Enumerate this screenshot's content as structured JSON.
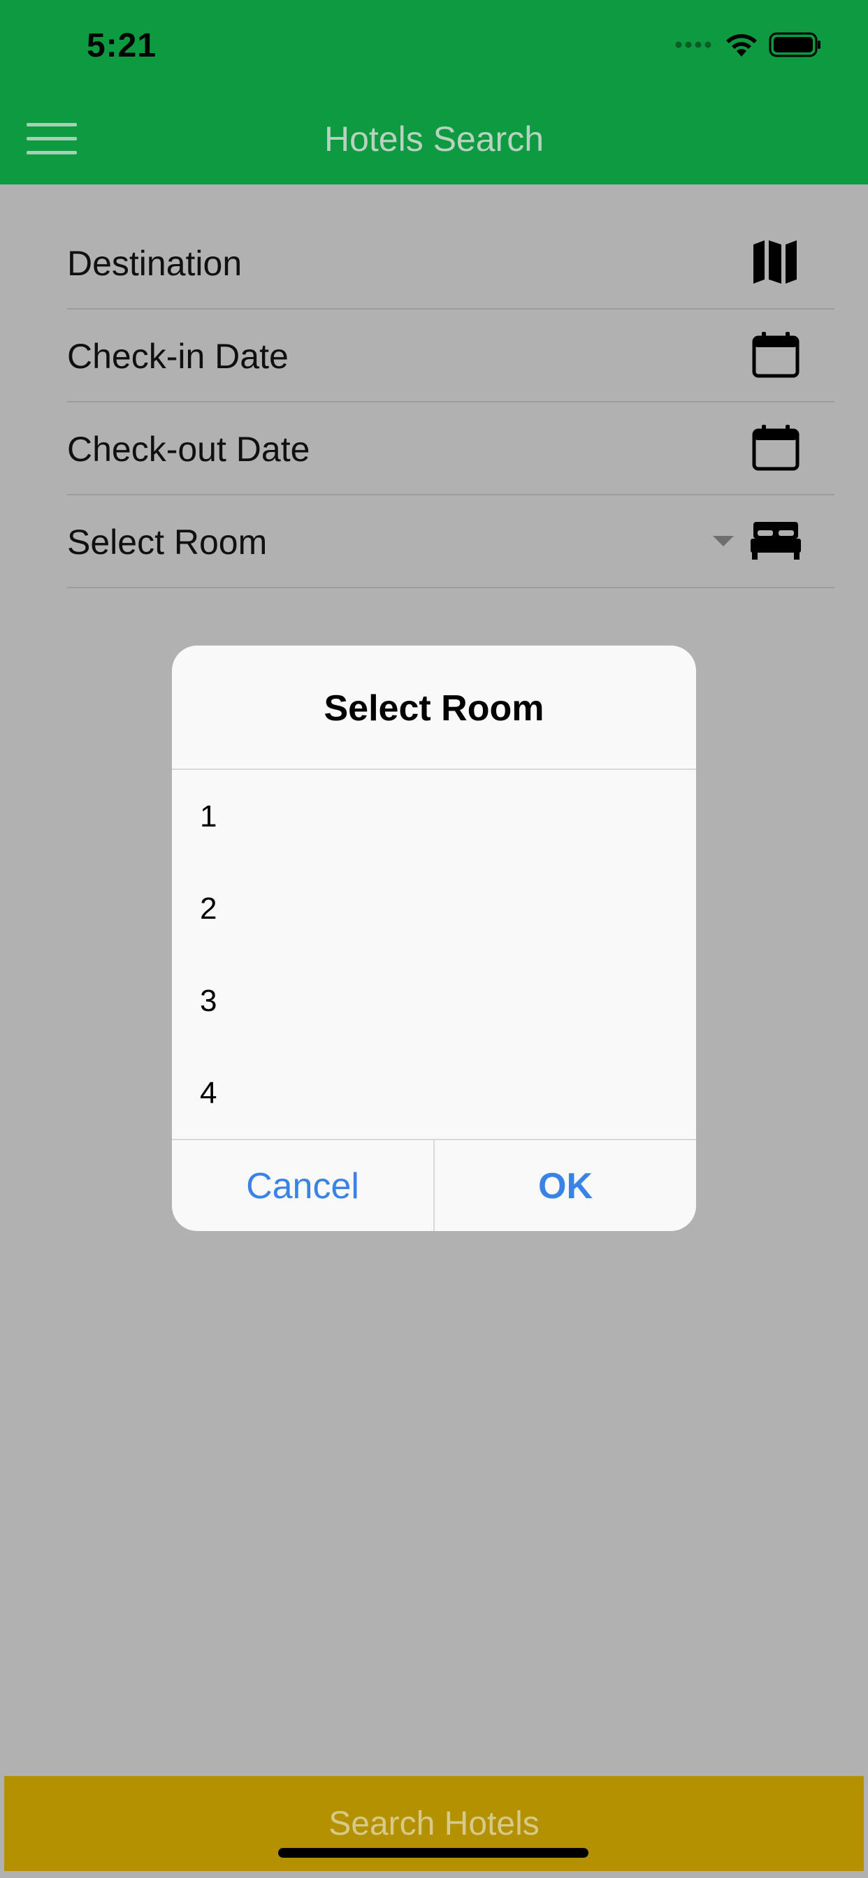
{
  "status_bar": {
    "time": "5:21",
    "icons": [
      "signal-dots-icon",
      "wifi-icon",
      "battery-icon"
    ]
  },
  "nav": {
    "title": "Hotels Search",
    "menu_icon": "hamburger-menu-icon"
  },
  "form": {
    "rows": [
      {
        "label": "Destination",
        "icon": "map-icon"
      },
      {
        "label": "Check-in Date",
        "icon": "calendar-icon"
      },
      {
        "label": "Check-out Date",
        "icon": "calendar-icon"
      },
      {
        "label": "Select Room",
        "icon": "bed-icon",
        "has_dropdown": true
      }
    ]
  },
  "dialog": {
    "title": "Select Room",
    "options": [
      "1",
      "2",
      "3",
      "4"
    ],
    "cancel_label": "Cancel",
    "ok_label": "OK"
  },
  "footer": {
    "search_label": "Search Hotels"
  },
  "colors": {
    "header": "#0d9a40",
    "dim_background": "#b1b1b1",
    "dialog_background": "#f9f9f9",
    "action_text": "#3a83e6",
    "search_button": "#b39100"
  }
}
